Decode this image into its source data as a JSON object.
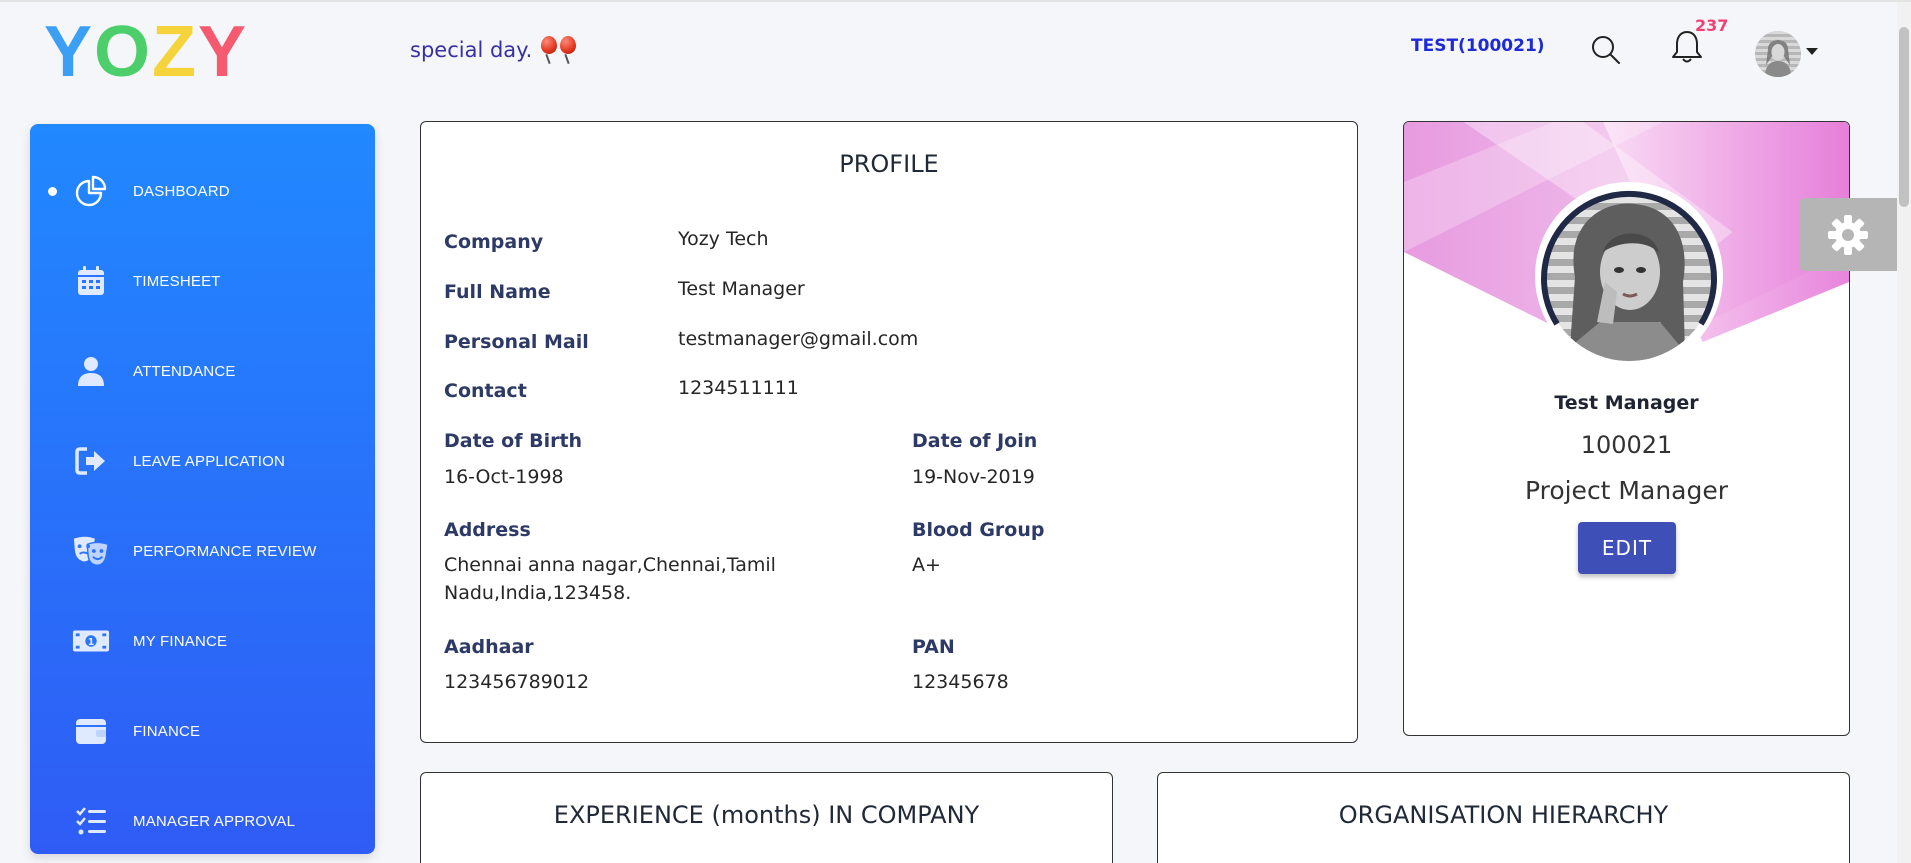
{
  "brand": {
    "letters": [
      {
        "char": "Y",
        "color": "#3b9ff5"
      },
      {
        "char": "O",
        "color": "#4ccf6b"
      },
      {
        "char": "Z",
        "color": "#f5d33b"
      },
      {
        "char": "Y",
        "color": "#f55a6f"
      }
    ]
  },
  "header": {
    "tagline": "special day.",
    "user_code": "TEST(100021)",
    "notification_count": "237"
  },
  "sidebar": {
    "items": [
      {
        "label": "DASHBOARD",
        "icon": "chart-pie-icon",
        "active": true
      },
      {
        "label": "TIMESHEET",
        "icon": "calendar-icon"
      },
      {
        "label": "ATTENDANCE",
        "icon": "user-icon"
      },
      {
        "label": "LEAVE APPLICATION",
        "icon": "sign-out-icon"
      },
      {
        "label": "PERFORMANCE REVIEW",
        "icon": "masks-icon"
      },
      {
        "label": "MY FINANCE",
        "icon": "money-bill-icon"
      },
      {
        "label": "FINANCE",
        "icon": "wallet-icon"
      },
      {
        "label": "MANAGER APPROVAL",
        "icon": "tasks-icon"
      }
    ]
  },
  "profile": {
    "title": "PROFILE",
    "company_label": "Company",
    "company": "Yozy Tech",
    "full_name_label": "Full Name",
    "full_name": "Test Manager",
    "mail_label": "Personal Mail",
    "mail": "testmanager@gmail.com",
    "contact_label": "Contact",
    "contact": "1234511111",
    "dob_label": "Date of Birth",
    "dob": "16-Oct-1998",
    "doj_label": "Date of Join",
    "doj": "19-Nov-2019",
    "address_label": "Address",
    "address_line1": "Chennai anna nagar,Chennai,Tamil",
    "address_line2": "Nadu,India,123458.",
    "blood_label": "Blood Group",
    "blood": "A+",
    "aadhaar_label": "Aadhaar",
    "aadhaar": "123456789012",
    "pan_label": "PAN",
    "pan": "12345678"
  },
  "summary": {
    "name": "Test Manager",
    "employee_id": "100021",
    "role": "Project Manager",
    "edit_label": "EDIT"
  },
  "bottom": {
    "experience_title": "EXPERIENCE (months) IN COMPANY",
    "org_title": "ORGANISATION HIERARCHY"
  },
  "colors": {
    "sidebar_top": "#2188ff",
    "sidebar_bottom": "#2f5cf5",
    "edit_button": "#3f4fb8",
    "badge": "#f43f74",
    "label": "#2e3a66"
  }
}
